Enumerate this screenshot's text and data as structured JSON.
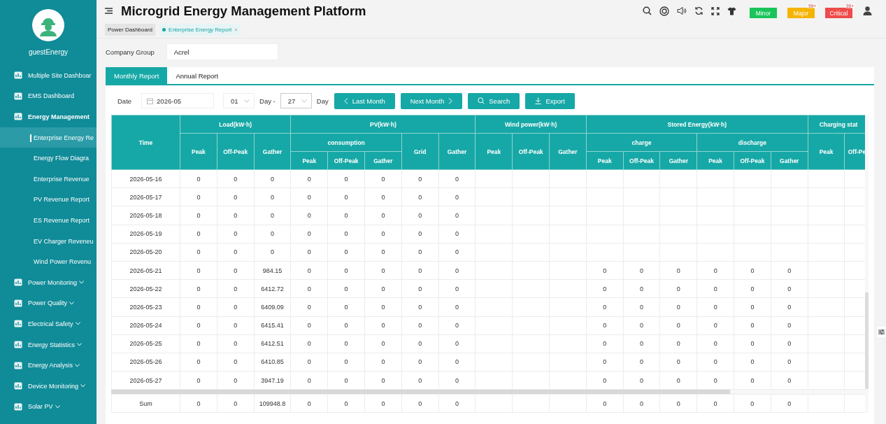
{
  "sidebar": {
    "user": "guestEnergy",
    "items": [
      {
        "label": "Multiple Site Dashboar",
        "selected": false,
        "expandable": false
      },
      {
        "label": "EMS Dashboard",
        "selected": false,
        "expandable": false
      },
      {
        "label": "Energy Management",
        "selected": false,
        "expandable": false,
        "children": [
          {
            "label": "Enterprise Energy Re",
            "selected": true
          },
          {
            "label": "Energy Flow Diagra",
            "selected": false
          },
          {
            "label": "Enterprise Revenue",
            "selected": false
          },
          {
            "label": "PV Revenue Report",
            "selected": false
          },
          {
            "label": "ES Revenue Report",
            "selected": false
          },
          {
            "label": "EV Charger Reveneu",
            "selected": false
          },
          {
            "label": "Wind Power Revenu",
            "selected": false
          }
        ]
      },
      {
        "label": "Power Monitoring",
        "selected": false,
        "expandable": true
      },
      {
        "label": "Power Quality",
        "selected": false,
        "expandable": true
      },
      {
        "label": "Electrical Safety",
        "selected": false,
        "expandable": true
      },
      {
        "label": "Energy Statistics",
        "selected": false,
        "expandable": true
      },
      {
        "label": "Energy Analysis",
        "selected": false,
        "expandable": true
      },
      {
        "label": "Device Monitoring",
        "selected": false,
        "expandable": true
      },
      {
        "label": "Solar PV",
        "selected": false,
        "expandable": true
      }
    ]
  },
  "header": {
    "title": "Microgrid Energy Management Platform",
    "alarms": [
      {
        "label": "Minor",
        "color": "#19c45a"
      },
      {
        "label": "Major",
        "color": "#f5b400",
        "count": "99+"
      },
      {
        "label": "Critical",
        "color": "#ef4b4b",
        "count": "99+"
      }
    ]
  },
  "page_tabs": [
    {
      "label": "Power Dashboard",
      "selected": false
    },
    {
      "label": "Enterprise Energy Report",
      "selected": true,
      "close": "×"
    }
  ],
  "filter": {
    "label": "Company Group",
    "value": "Acrel"
  },
  "report_tabs": [
    {
      "label": "Monthly Report",
      "selected": true
    },
    {
      "label": "Annual Report",
      "selected": false
    }
  ],
  "toolbar": {
    "date_label": "Date",
    "date": "2026-05",
    "day_from": "01",
    "day_sep": "Day -",
    "day_to": "27",
    "day_unit": "Day",
    "buttons": [
      {
        "label": "Last Month",
        "kind": "prev"
      },
      {
        "label": "Next Month",
        "kind": "next"
      },
      {
        "label": "Search",
        "kind": "search"
      },
      {
        "label": "Export",
        "kind": "export"
      }
    ]
  },
  "table": {
    "time_label": "Time",
    "groups": [
      {
        "label": "Load(kW·h)",
        "columns": [
          {
            "label": "Peak"
          },
          {
            "label": "Off-Peak"
          },
          {
            "label": "Gather"
          }
        ]
      },
      {
        "label": "PV(kW·h)",
        "columns": [
          {
            "label": "consumption",
            "columns": [
              {
                "label": "Peak"
              },
              {
                "label": "Off-Peak"
              },
              {
                "label": "Gather"
              }
            ]
          },
          {
            "label": "Grid"
          },
          {
            "label": "Gather"
          }
        ]
      },
      {
        "label": "Wind power(kW·h)",
        "columns": [
          {
            "label": "Peak"
          },
          {
            "label": "Off-Peak"
          },
          {
            "label": "Gather"
          }
        ]
      },
      {
        "label": "Stored Energy(kW·h)",
        "columns": [
          {
            "label": "charge",
            "columns": [
              {
                "label": "Peak"
              },
              {
                "label": "Off-Peak"
              },
              {
                "label": "Gather"
              }
            ]
          },
          {
            "label": "discharge",
            "columns": [
              {
                "label": "Peak"
              },
              {
                "label": "Off-Peak"
              },
              {
                "label": "Gather"
              }
            ]
          }
        ]
      },
      {
        "label": "Charging stat",
        "columns": [
          {
            "label": "Peak"
          },
          {
            "label": "Off-Pe"
          }
        ]
      }
    ],
    "rows": [
      {
        "time": "2026-05-16",
        "cells": [
          "0",
          "0",
          "0",
          "0",
          "0",
          "0",
          "0",
          "0",
          null,
          null,
          null,
          null,
          null,
          null,
          null,
          null,
          null,
          null,
          null
        ]
      },
      {
        "time": "2026-05-17",
        "cells": [
          "0",
          "0",
          "0",
          "0",
          "0",
          "0",
          "0",
          "0",
          null,
          null,
          null,
          null,
          null,
          null,
          null,
          null,
          null,
          null,
          null
        ]
      },
      {
        "time": "2026-05-18",
        "cells": [
          "0",
          "0",
          "0",
          "0",
          "0",
          "0",
          "0",
          "0",
          null,
          null,
          null,
          null,
          null,
          null,
          null,
          null,
          null,
          null,
          null
        ]
      },
      {
        "time": "2026-05-19",
        "cells": [
          "0",
          "0",
          "0",
          "0",
          "0",
          "0",
          "0",
          "0",
          null,
          null,
          null,
          null,
          null,
          null,
          null,
          null,
          null,
          null,
          null
        ]
      },
      {
        "time": "2026-05-20",
        "cells": [
          "0",
          "0",
          "0",
          "0",
          "0",
          "0",
          "0",
          "0",
          null,
          null,
          null,
          null,
          null,
          null,
          null,
          null,
          null,
          null,
          null
        ]
      },
      {
        "time": "2026-05-21",
        "cells": [
          "0",
          "0",
          "984.15",
          "0",
          "0",
          "0",
          "0",
          "0",
          null,
          null,
          null,
          "0",
          "0",
          "0",
          "0",
          "0",
          "0",
          null,
          null
        ]
      },
      {
        "time": "2026-05-22",
        "cells": [
          "0",
          "0",
          "6412.72",
          "0",
          "0",
          "0",
          "0",
          "0",
          null,
          null,
          null,
          "0",
          "0",
          "0",
          "0",
          "0",
          "0",
          null,
          null
        ]
      },
      {
        "time": "2026-05-23",
        "cells": [
          "0",
          "0",
          "6409.09",
          "0",
          "0",
          "0",
          "0",
          "0",
          null,
          null,
          null,
          "0",
          "0",
          "0",
          "0",
          "0",
          "0",
          null,
          null
        ]
      },
      {
        "time": "2026-05-24",
        "cells": [
          "0",
          "0",
          "6415.41",
          "0",
          "0",
          "0",
          "0",
          "0",
          null,
          null,
          null,
          "0",
          "0",
          "0",
          "0",
          "0",
          "0",
          null,
          null
        ]
      },
      {
        "time": "2026-05-25",
        "cells": [
          "0",
          "0",
          "6412.51",
          "0",
          "0",
          "0",
          "0",
          "0",
          null,
          null,
          null,
          "0",
          "0",
          "0",
          "0",
          "0",
          "0",
          null,
          null
        ]
      },
      {
        "time": "2026-05-26",
        "cells": [
          "0",
          "0",
          "6410.85",
          "0",
          "0",
          "0",
          "0",
          "0",
          null,
          null,
          null,
          "0",
          "0",
          "0",
          "0",
          "0",
          "0",
          null,
          null
        ]
      },
      {
        "time": "2026-05-27",
        "cells": [
          "0",
          "0",
          "3947.19",
          "0",
          "0",
          "0",
          "0",
          "0",
          null,
          null,
          null,
          "0",
          "0",
          "0",
          "0",
          "0",
          "0",
          null,
          null
        ]
      }
    ],
    "sum": {
      "time": "Sum",
      "cells": [
        "0",
        "0",
        "109948.8",
        "0",
        "0",
        "0",
        "0",
        "0",
        null,
        null,
        null,
        "0",
        "0",
        "0",
        "0",
        "0",
        "0",
        null,
        null
      ]
    }
  }
}
